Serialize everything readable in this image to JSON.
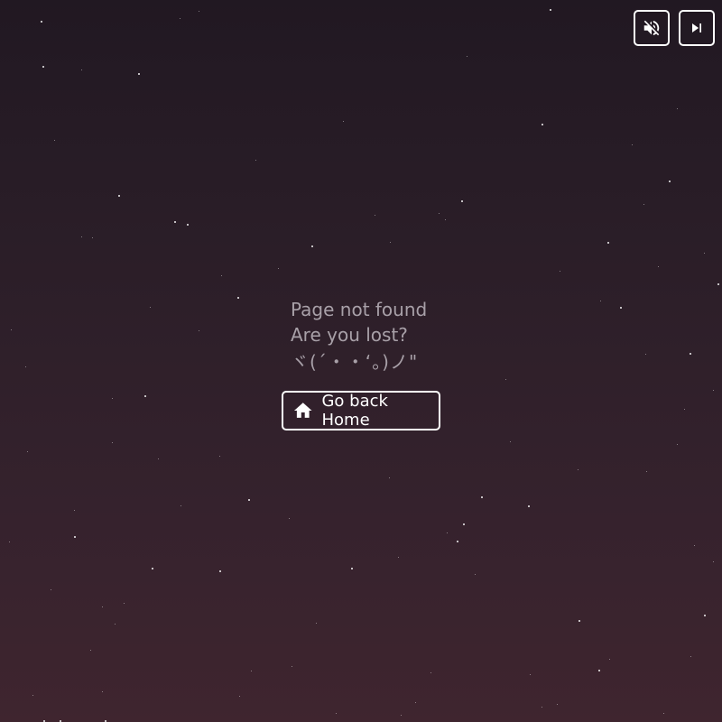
{
  "controls": {
    "mute_icon": "volume-off-icon",
    "skip_icon": "skip-next-icon"
  },
  "message": {
    "line1": "Page not found",
    "line2": "Are you lost?",
    "kaomoji": "ヾ(´・・‘。)ノ\""
  },
  "home_button": {
    "icon": "home-icon",
    "label": "Go back Home"
  },
  "colors": {
    "bg_top": "#211822",
    "bg_bottom": "#3f252f",
    "message_text": "#a8a0a8",
    "button_border": "#ffffff"
  }
}
